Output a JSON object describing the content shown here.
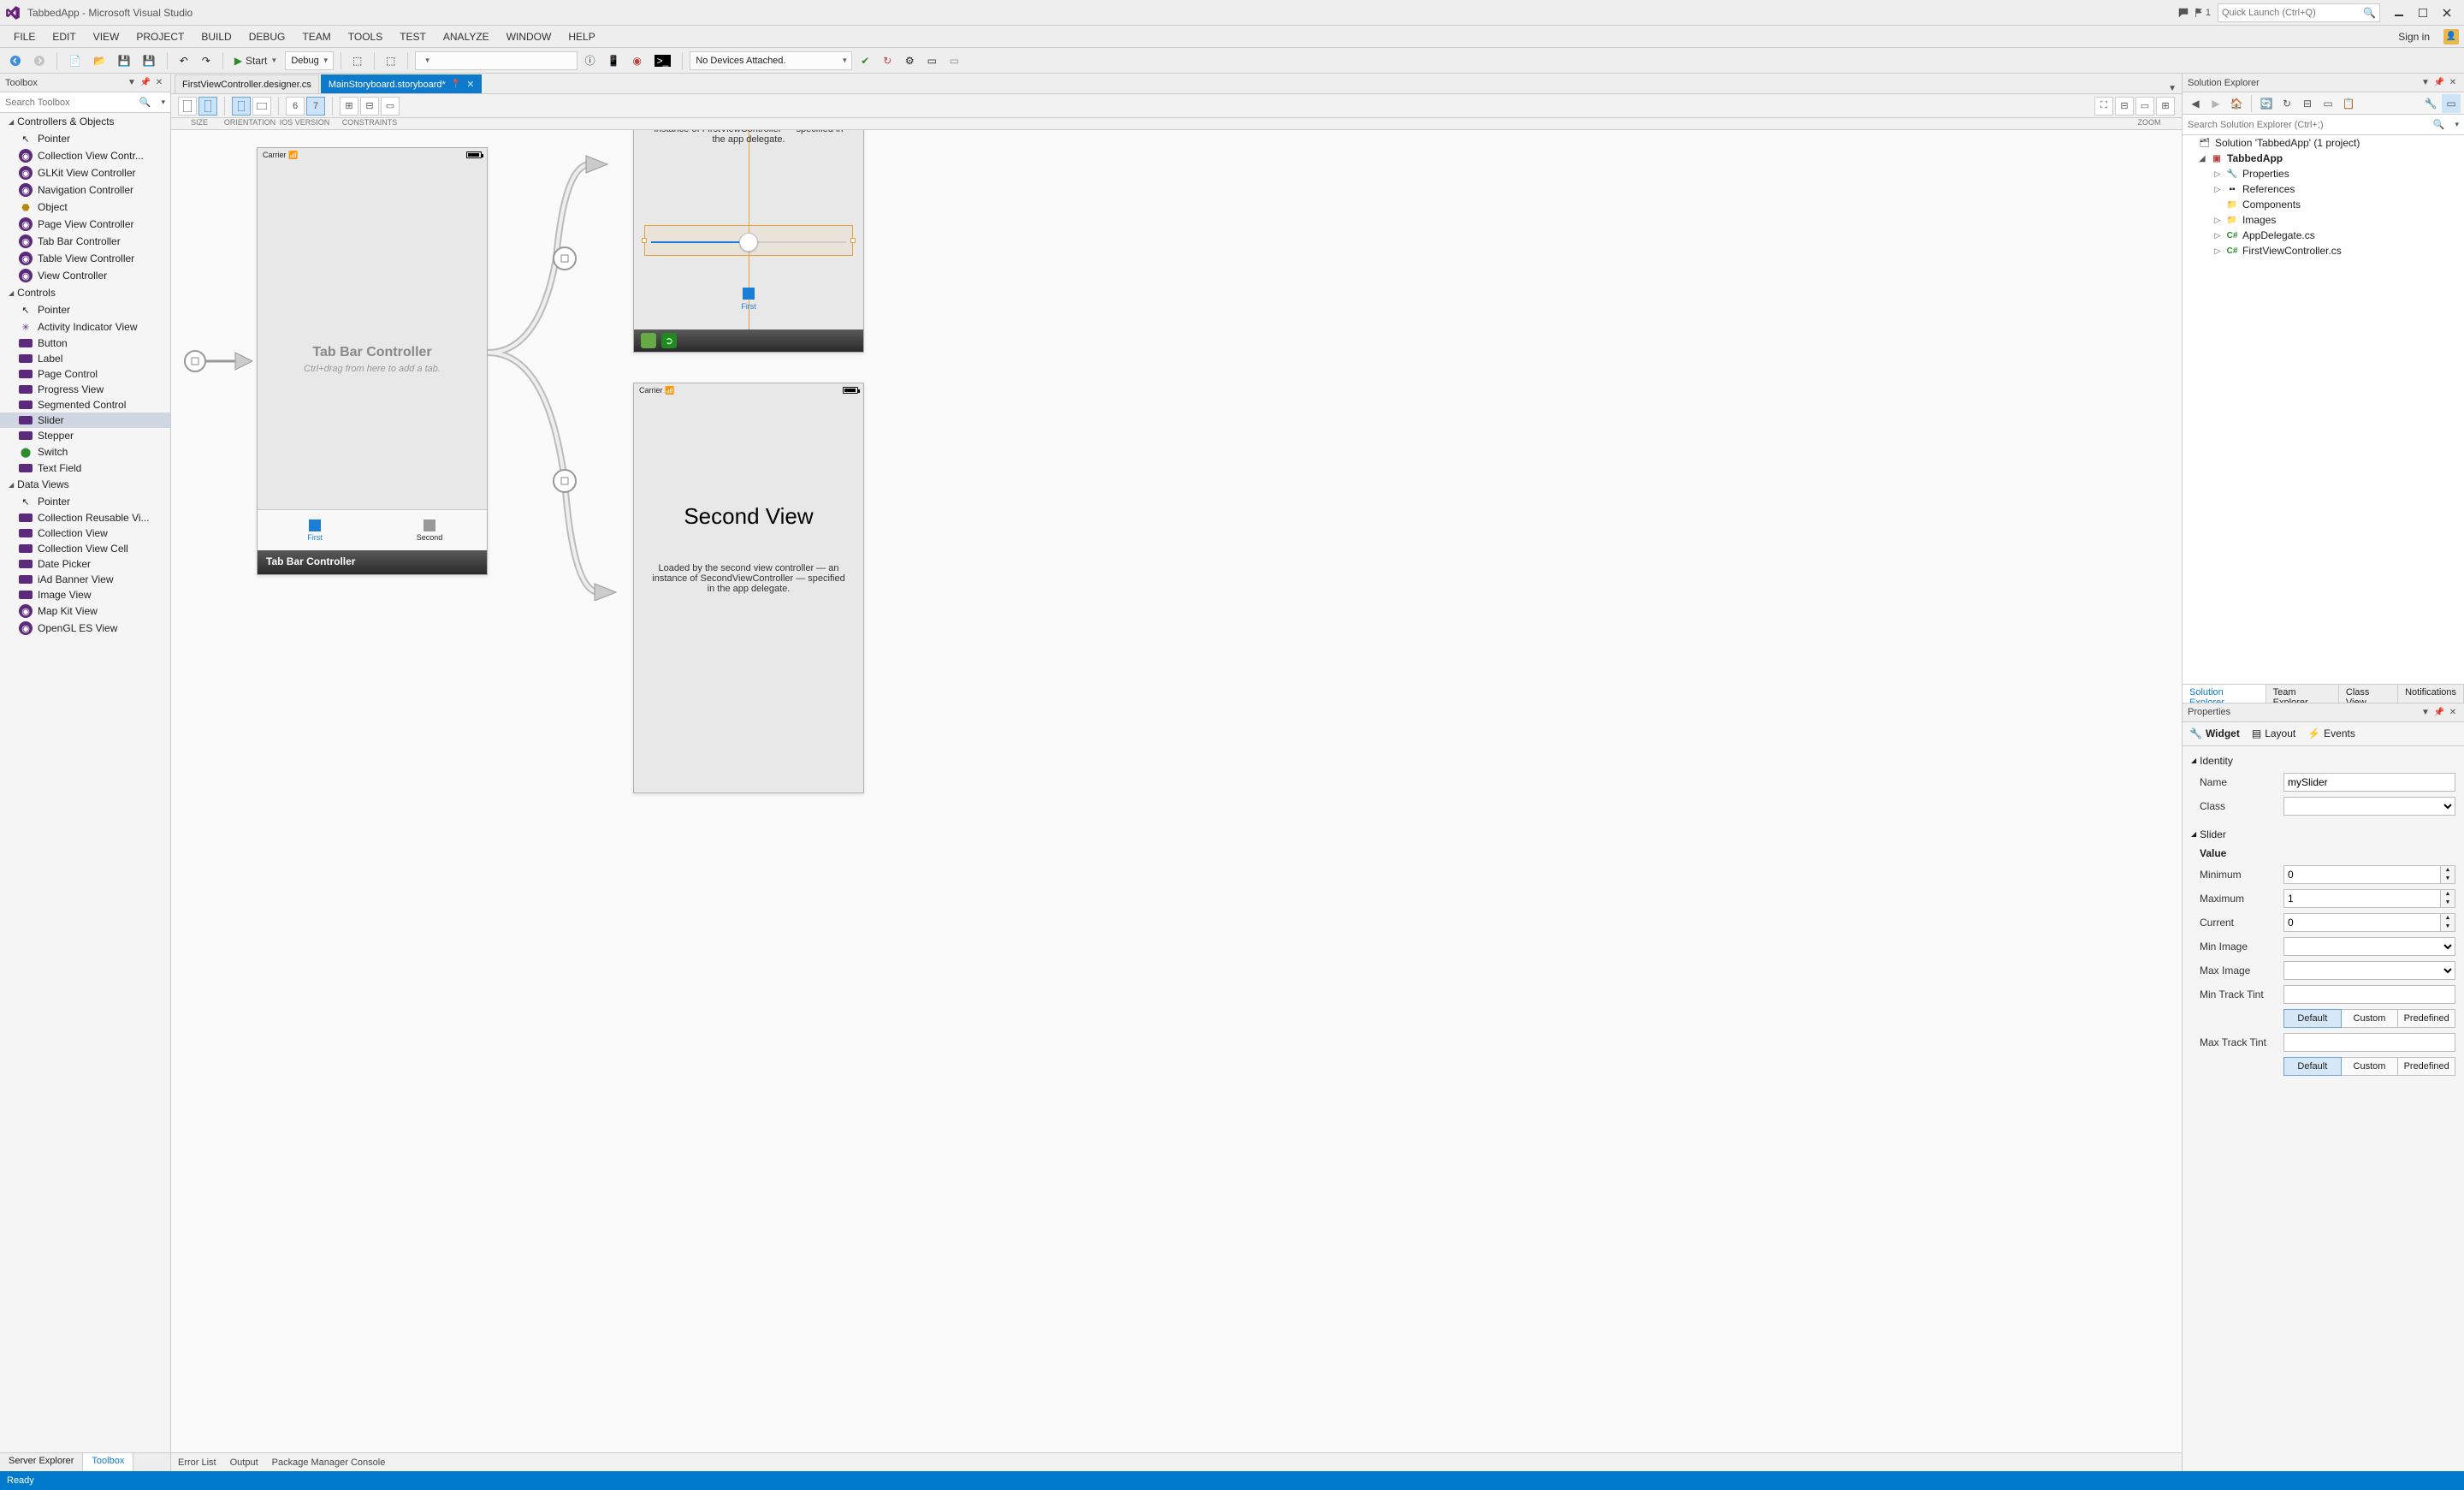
{
  "titlebar": {
    "title": "TabbedApp - Microsoft Visual Studio",
    "flag_count": "1",
    "quick_launch_placeholder": "Quick Launch (Ctrl+Q)"
  },
  "menubar": {
    "items": [
      "FILE",
      "EDIT",
      "VIEW",
      "PROJECT",
      "BUILD",
      "DEBUG",
      "TEAM",
      "TOOLS",
      "TEST",
      "ANALYZE",
      "WINDOW",
      "HELP"
    ],
    "signin": "Sign in"
  },
  "toolbar": {
    "start": "Start",
    "config": "Debug",
    "platform_dd": "",
    "devices": "No Devices Attached."
  },
  "toolbox": {
    "title": "Toolbox",
    "search_placeholder": "Search Toolbox",
    "groups": [
      {
        "name": "Controllers & Objects",
        "items": [
          "Pointer",
          "Collection View Contr...",
          "GLKit View Controller",
          "Navigation Controller",
          "Object",
          "Page View Controller",
          "Tab Bar Controller",
          "Table View Controller",
          "View Controller"
        ]
      },
      {
        "name": "Controls",
        "items": [
          "Pointer",
          "Activity Indicator View",
          "Button",
          "Label",
          "Page Control",
          "Progress View",
          "Segmented Control",
          "Slider",
          "Stepper",
          "Switch",
          "Text Field"
        ],
        "selected": "Slider"
      },
      {
        "name": "Data Views",
        "items": [
          "Pointer",
          "Collection Reusable Vi...",
          "Collection View",
          "Collection View Cell",
          "Date Picker",
          "iAd Banner View",
          "Image View",
          "Map Kit View",
          "OpenGL ES View"
        ]
      }
    ],
    "bottom_tabs": [
      "Server Explorer",
      "Toolbox"
    ]
  },
  "doc_tabs": [
    {
      "label": "FirstViewController.designer.cs",
      "active": false
    },
    {
      "label": "MainStoryboard.storyboard*",
      "active": true
    }
  ],
  "designer_bar": {
    "size_label": "SIZE",
    "orientation_label": "ORIENTATION",
    "ios_version_label": "iOS VERSION",
    "ios_versions": [
      "6",
      "7"
    ],
    "constraints_label": "CONSTRAINTS",
    "zoom_label": "ZOOM"
  },
  "storyboard": {
    "tabbarcontroller": {
      "carrier": "Carrier",
      "title": "Tab Bar Controller",
      "subtitle": "Ctrl+drag from here to add a tab.",
      "tabs": [
        {
          "label": "First",
          "active": true
        },
        {
          "label": "Second",
          "active": false
        }
      ],
      "footer": "Tab Bar Controller"
    },
    "first": {
      "desc": "Loaded by the first view controller — an instance of FirstViewController — specified in the app delegate.",
      "tab_label": "First"
    },
    "second": {
      "carrier": "Carrier",
      "title": "Second View",
      "desc": "Loaded by the second view controller — an instance of SecondViewController — specified in the app delegate."
    }
  },
  "solution": {
    "title": "Solution Explorer",
    "search_placeholder": "Search Solution Explorer (Ctrl+;)",
    "root": "Solution 'TabbedApp' (1 project)",
    "project": "TabbedApp",
    "nodes": [
      "Properties",
      "References",
      "Components",
      "Images",
      "AppDelegate.cs",
      "FirstViewController.cs"
    ],
    "tabs": [
      "Solution Explorer",
      "Team Explorer",
      "Class View",
      "Notifications"
    ]
  },
  "properties": {
    "title": "Properties",
    "tabs": [
      "Widget",
      "Layout",
      "Events"
    ],
    "identity": {
      "header": "Identity",
      "name_label": "Name",
      "name_value": "mySlider",
      "class_label": "Class",
      "class_value": ""
    },
    "slider": {
      "header": "Slider",
      "value_header": "Value",
      "minimum": {
        "label": "Minimum",
        "value": "0"
      },
      "maximum": {
        "label": "Maximum",
        "value": "1"
      },
      "current": {
        "label": "Current",
        "value": "0"
      },
      "min_image": {
        "label": "Min Image",
        "value": ""
      },
      "max_image": {
        "label": "Max Image",
        "value": ""
      },
      "min_track": {
        "label": "Min Track Tint",
        "buttons": [
          "Default",
          "Custom",
          "Predefined"
        ]
      },
      "max_track": {
        "label": "Max Track Tint",
        "buttons": [
          "Default",
          "Custom",
          "Predefined"
        ]
      }
    }
  },
  "bottom_row": [
    "Error List",
    "Output",
    "Package Manager Console"
  ],
  "status": "Ready"
}
